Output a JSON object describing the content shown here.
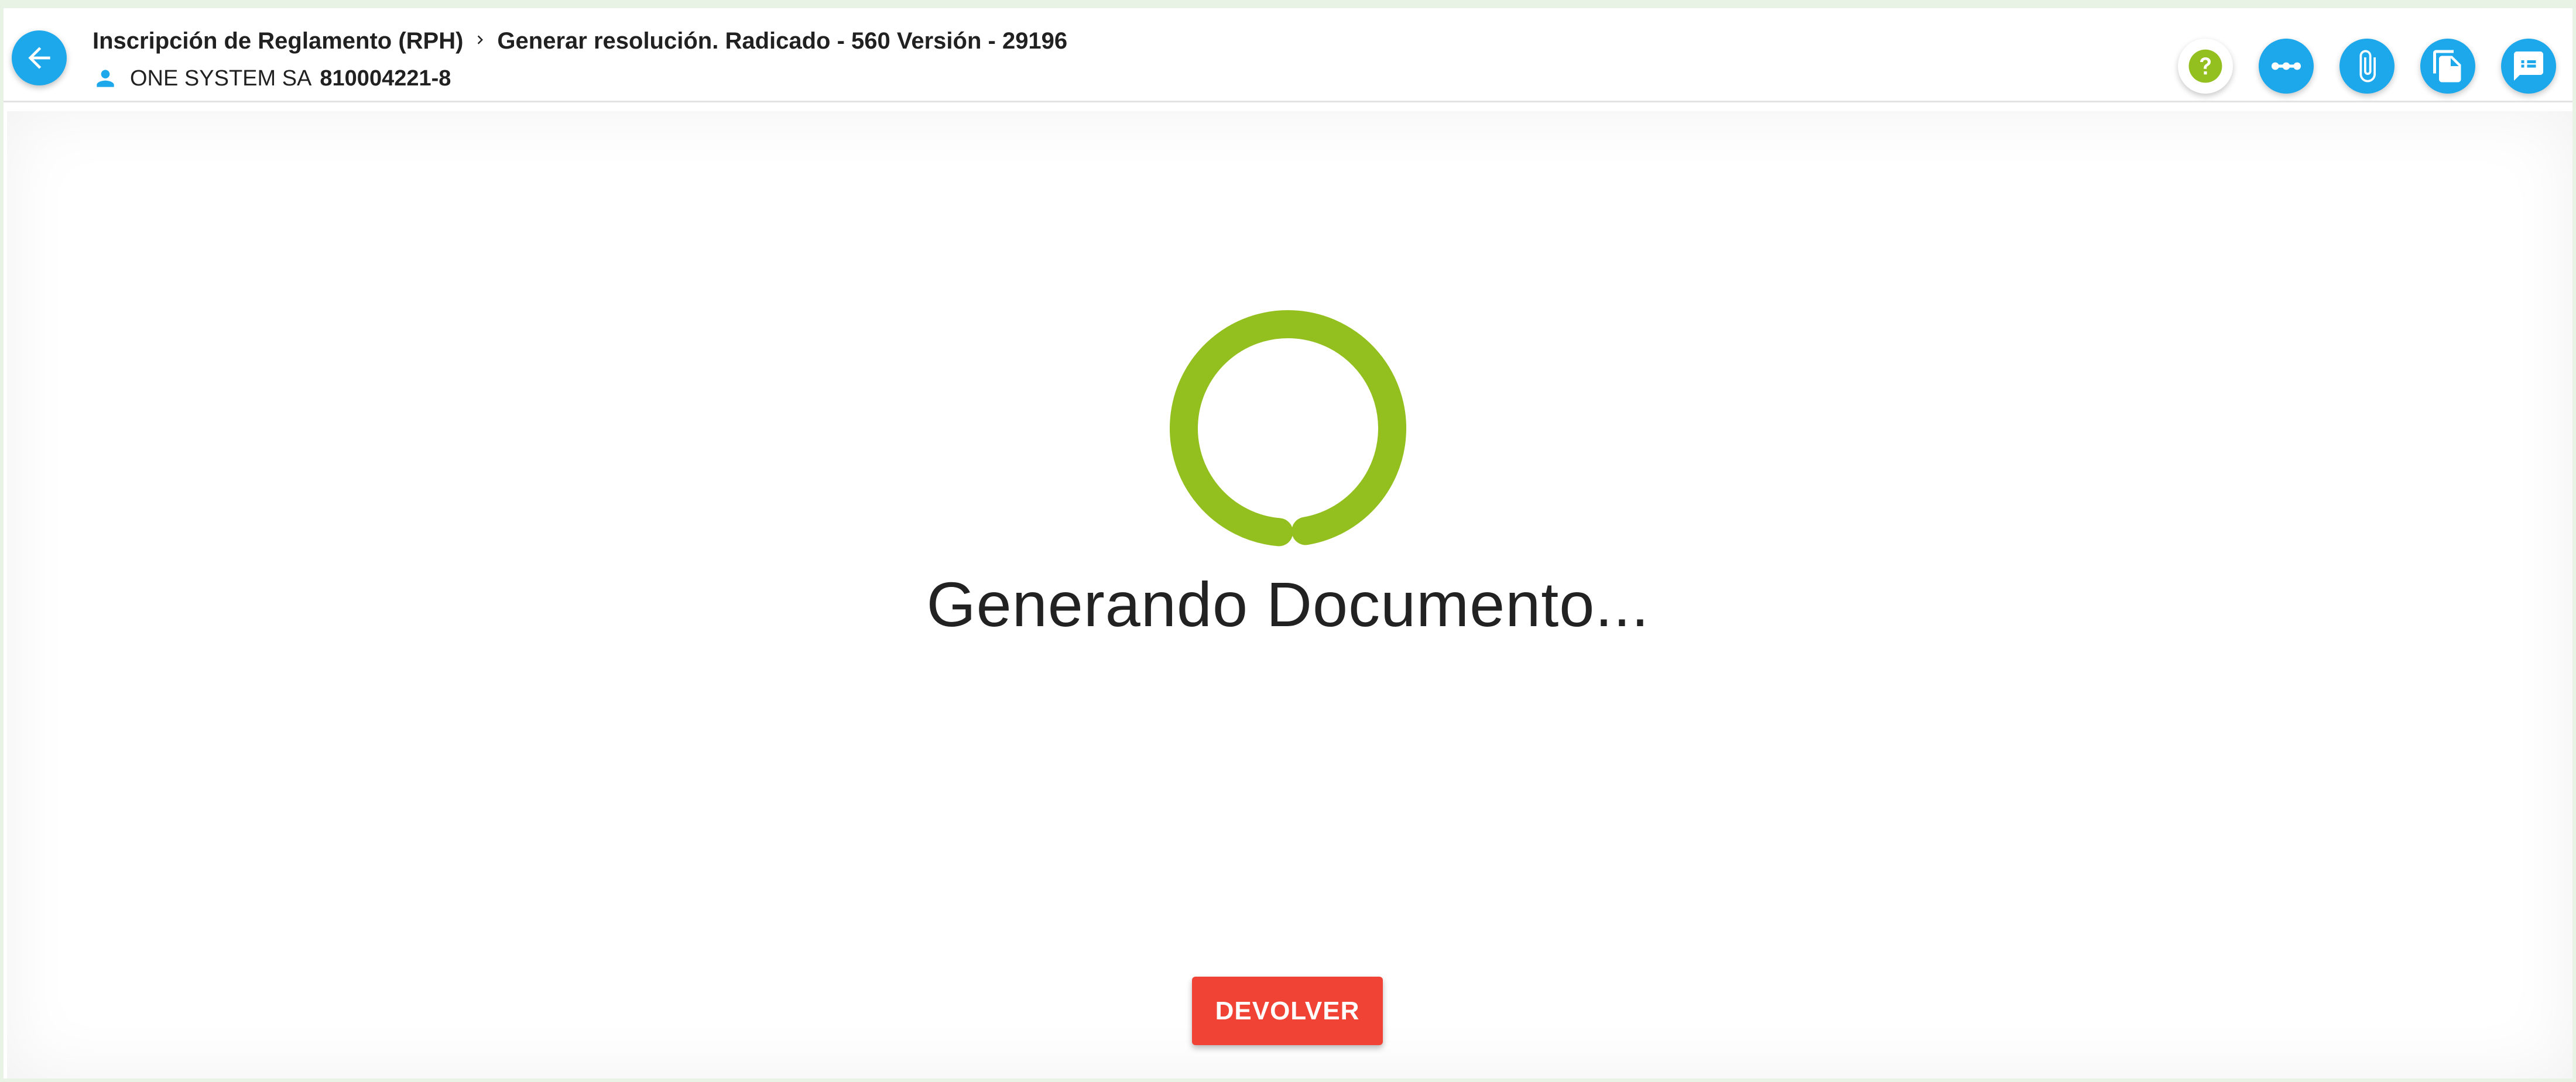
{
  "header": {
    "breadcrumb": {
      "parent": "Inscripción de Reglamento (RPH)",
      "current": "Generar resolución. Radicado - 560 Versión - 29196"
    },
    "user": {
      "name": "ONE SYSTEM SA",
      "id": "810004221-8"
    }
  },
  "actions": [
    {
      "name": "help",
      "icon": "question-icon"
    },
    {
      "name": "workflow",
      "icon": "dots-icon"
    },
    {
      "name": "attachments",
      "icon": "paperclip-icon"
    },
    {
      "name": "documents",
      "icon": "document-icon"
    },
    {
      "name": "comments",
      "icon": "comment-icon"
    }
  ],
  "main": {
    "status_text": "Generando Documento...",
    "return_button": "DEVOLVER"
  },
  "colors": {
    "accent": "#1ea8ec",
    "spinner": "#93c01f",
    "danger": "#f04336"
  }
}
